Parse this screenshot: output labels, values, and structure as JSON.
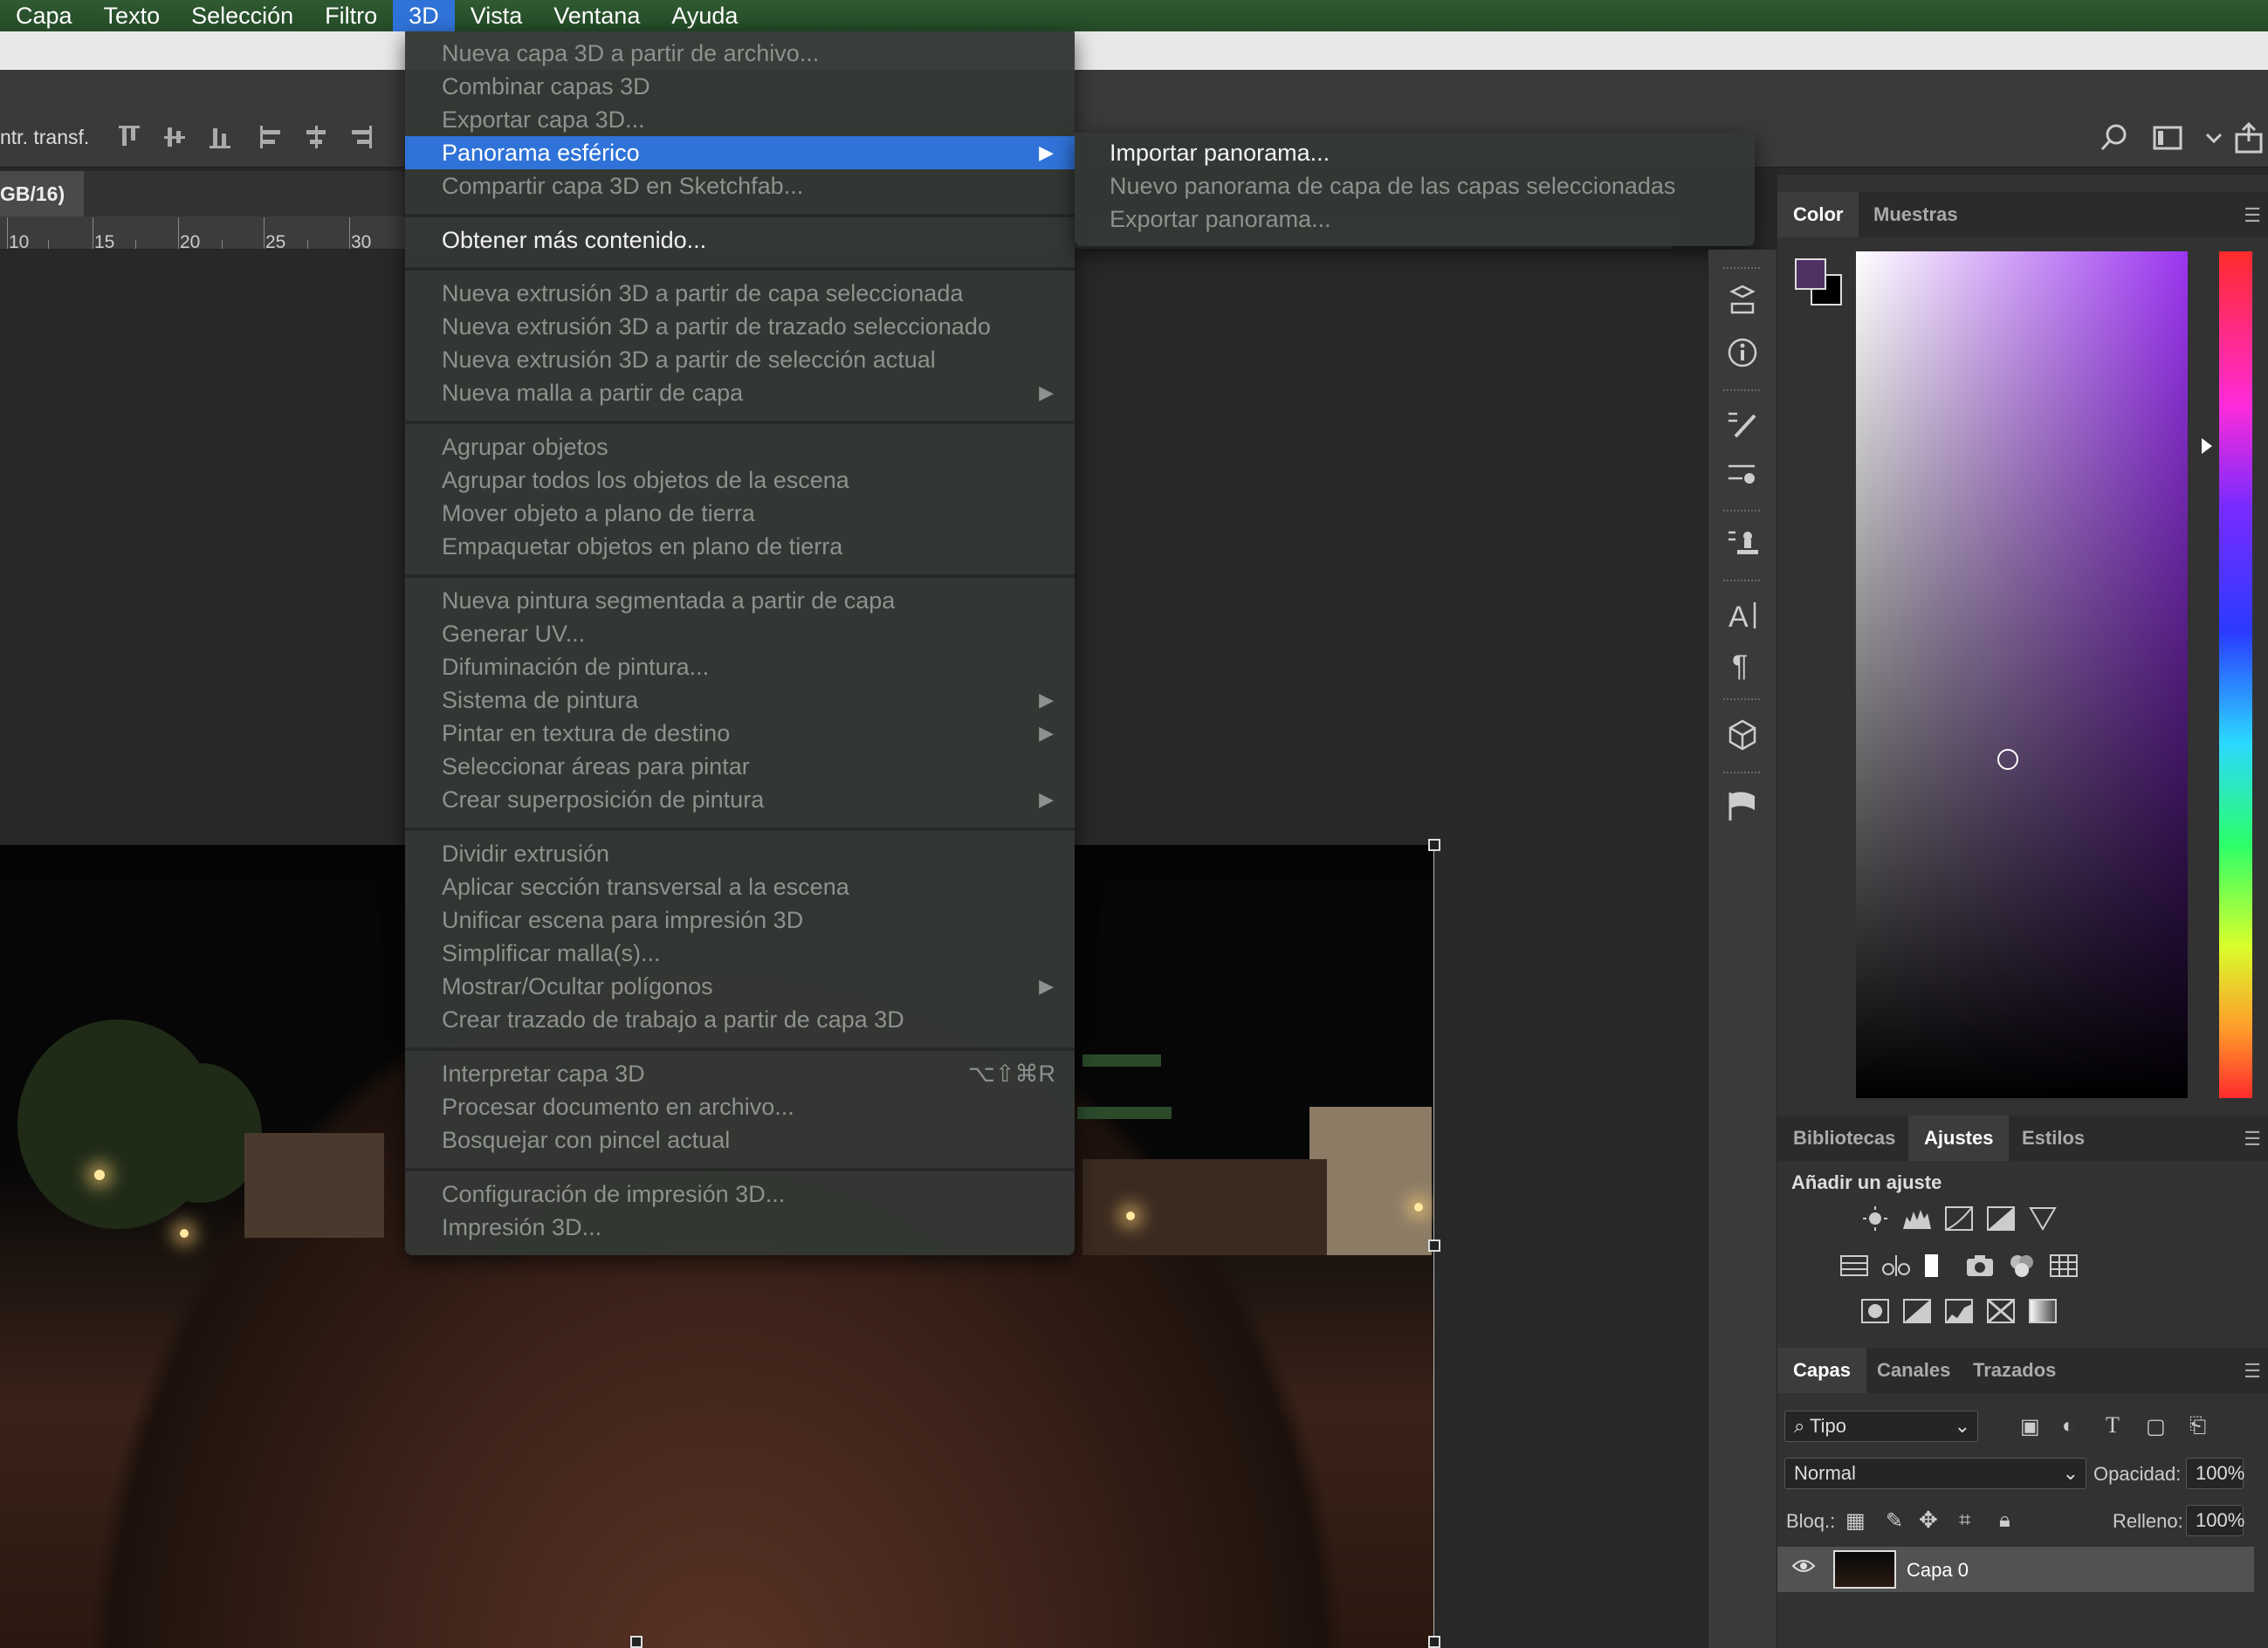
{
  "menubar": {
    "items": [
      "Capa",
      "Texto",
      "Selección",
      "Filtro",
      "3D",
      "Vista",
      "Ventana",
      "Ayuda"
    ],
    "active_index": 4
  },
  "options_bar": {
    "transform_label": "ntr. transf."
  },
  "document": {
    "tab_label": "GB/16)"
  },
  "ruler": {
    "ticks": [
      "10",
      "15",
      "20",
      "25",
      "30"
    ]
  },
  "menu_3d": {
    "items": [
      {
        "label": "Nueva capa 3D a partir de archivo...",
        "enabled": false
      },
      {
        "label": "Combinar capas 3D",
        "enabled": false
      },
      {
        "label": "Exportar capa 3D...",
        "enabled": false
      },
      {
        "label": "Panorama esférico",
        "enabled": true,
        "highlighted": true,
        "submenu": true
      },
      {
        "label": "Compartir capa 3D en Sketchfab...",
        "enabled": false
      },
      {
        "label": "Obtener más contenido...",
        "enabled": true
      },
      {
        "label": "Nueva extrusión 3D a partir de capa seleccionada",
        "enabled": false
      },
      {
        "label": "Nueva extrusión 3D a partir de trazado seleccionado",
        "enabled": false
      },
      {
        "label": "Nueva extrusión 3D a partir de selección actual",
        "enabled": false
      },
      {
        "label": "Nueva malla a partir de capa",
        "enabled": false,
        "submenu": true
      },
      {
        "label": "Agrupar objetos",
        "enabled": false
      },
      {
        "label": "Agrupar todos los objetos de la escena",
        "enabled": false
      },
      {
        "label": "Mover objeto a plano de tierra",
        "enabled": false
      },
      {
        "label": "Empaquetar objetos en plano de tierra",
        "enabled": false
      },
      {
        "label": "Nueva pintura segmentada a partir de capa",
        "enabled": false
      },
      {
        "label": "Generar UV...",
        "enabled": false
      },
      {
        "label": "Difuminación de pintura...",
        "enabled": false
      },
      {
        "label": "Sistema de pintura",
        "enabled": false,
        "submenu": true
      },
      {
        "label": "Pintar en textura de destino",
        "enabled": false,
        "submenu": true
      },
      {
        "label": "Seleccionar áreas para pintar",
        "enabled": false
      },
      {
        "label": "Crear superposición de pintura",
        "enabled": false,
        "submenu": true
      },
      {
        "label": "Dividir extrusión",
        "enabled": false
      },
      {
        "label": "Aplicar sección transversal a la escena",
        "enabled": false
      },
      {
        "label": "Unificar escena para impresión 3D",
        "enabled": false
      },
      {
        "label": "Simplificar malla(s)...",
        "enabled": false
      },
      {
        "label": "Mostrar/Ocultar polígonos",
        "enabled": false,
        "submenu": true
      },
      {
        "label": "Crear trazado de trabajo a partir de capa 3D",
        "enabled": false
      },
      {
        "label": "Interpretar capa 3D",
        "enabled": false,
        "shortcut": "⌥⇧⌘R"
      },
      {
        "label": "Procesar documento en archivo...",
        "enabled": false
      },
      {
        "label": "Bosquejar con pincel actual",
        "enabled": false
      },
      {
        "label": "Configuración de impresión 3D...",
        "enabled": false
      },
      {
        "label": "Impresión 3D...",
        "enabled": false
      }
    ]
  },
  "submenu_panorama": {
    "items": [
      {
        "label": "Importar panorama...",
        "enabled": true
      },
      {
        "label": "Nuevo panorama de capa de las capas seleccionadas",
        "enabled": false
      },
      {
        "label": "Exportar panorama...",
        "enabled": false
      }
    ]
  },
  "color_panel": {
    "tabs": [
      "Color",
      "Muestras"
    ],
    "foreground": "#4f3163",
    "background": "#000000"
  },
  "adjust_panel": {
    "tabs": [
      "Bibliotecas",
      "Ajustes",
      "Estilos"
    ],
    "title": "Añadir un ajuste"
  },
  "layers_panel": {
    "tabs": [
      "Capas",
      "Canales",
      "Trazados"
    ],
    "filter": "Tipo",
    "blend_mode": "Normal",
    "opacity_label": "Opacidad:",
    "opacity_value": "100%",
    "lock_label": "Bloq.:",
    "fill_label": "Relleno:",
    "fill_value": "100%",
    "layers": [
      {
        "name": "Capa 0",
        "visible": true
      }
    ]
  }
}
